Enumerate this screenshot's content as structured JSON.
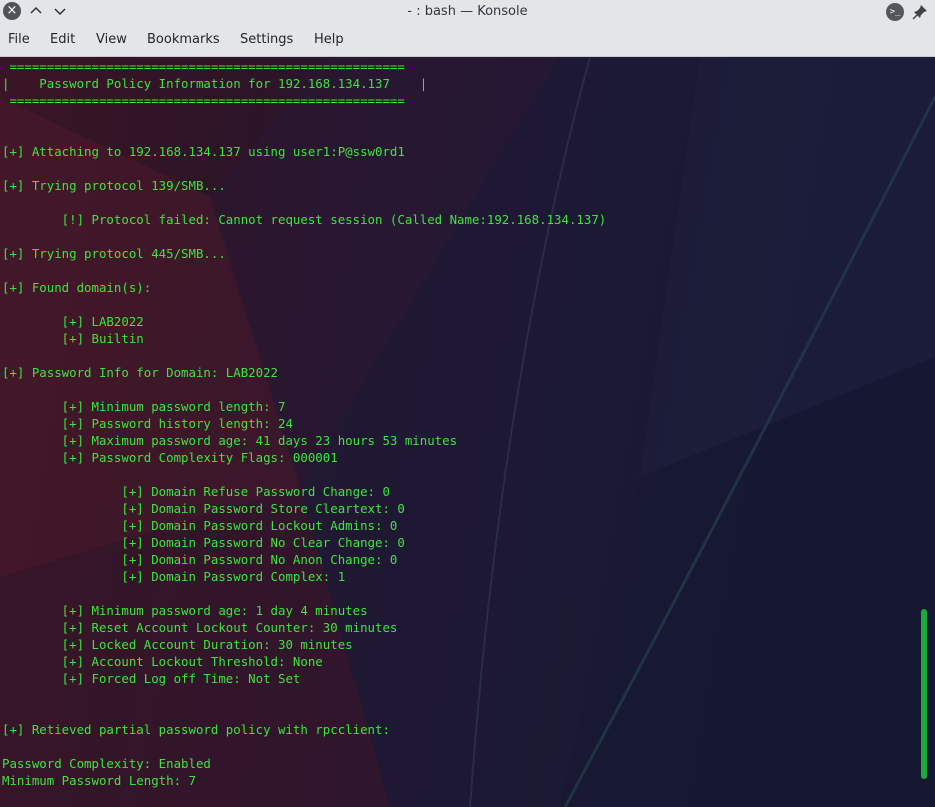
{
  "window": {
    "title": "- : bash — Konsole",
    "close_glyph": "×",
    "up_glyph": "^",
    "down_glyph": "v",
    "terminal_glyph": ">_",
    "pin_glyph": "📌"
  },
  "menu": [
    "File",
    "Edit",
    "View",
    "Bookmarks",
    "Settings",
    "Help"
  ],
  "terminal": {
    "lines": [
      " =====================================================",
      "|    Password Policy Information for 192.168.134.137    |",
      " =====================================================",
      "",
      "",
      "[+] Attaching to 192.168.134.137 using user1:P@ssw0rd1",
      "",
      "[+] Trying protocol 139/SMB...",
      "",
      "        [!] Protocol failed: Cannot request session (Called Name:192.168.134.137)",
      "",
      "[+] Trying protocol 445/SMB...",
      "",
      "[+] Found domain(s):",
      "",
      "        [+] LAB2022",
      "        [+] Builtin",
      "",
      "[+] Password Info for Domain: LAB2022",
      "",
      "        [+] Minimum password length: 7",
      "        [+] Password history length: 24",
      "        [+] Maximum password age: 41 days 23 hours 53 minutes",
      "        [+] Password Complexity Flags: 000001",
      "",
      "                [+] Domain Refuse Password Change: 0",
      "                [+] Domain Password Store Cleartext: 0",
      "                [+] Domain Password Lockout Admins: 0",
      "                [+] Domain Password No Clear Change: 0",
      "                [+] Domain Password No Anon Change: 0",
      "                [+] Domain Password Complex: 1",
      "",
      "        [+] Minimum password age: 1 day 4 minutes",
      "        [+] Reset Account Lockout Counter: 30 minutes",
      "        [+] Locked Account Duration: 30 minutes",
      "        [+] Account Lockout Threshold: None",
      "        [+] Forced Log off Time: Not Set",
      "",
      "",
      "[+] Retieved partial password policy with rpcclient:",
      "",
      "Password Complexity: Enabled",
      "Minimum Password Length: 7"
    ]
  },
  "colors": {
    "terminal_text": "#3de43d",
    "scrollbar": "#1bab3c",
    "titlebar_bg": "#e3e5e8"
  },
  "icons": {
    "close": "close-icon",
    "keep_above": "chevron-up-icon",
    "keep_below": "chevron-down-icon",
    "app": "terminal-icon",
    "pin": "pin-icon"
  }
}
